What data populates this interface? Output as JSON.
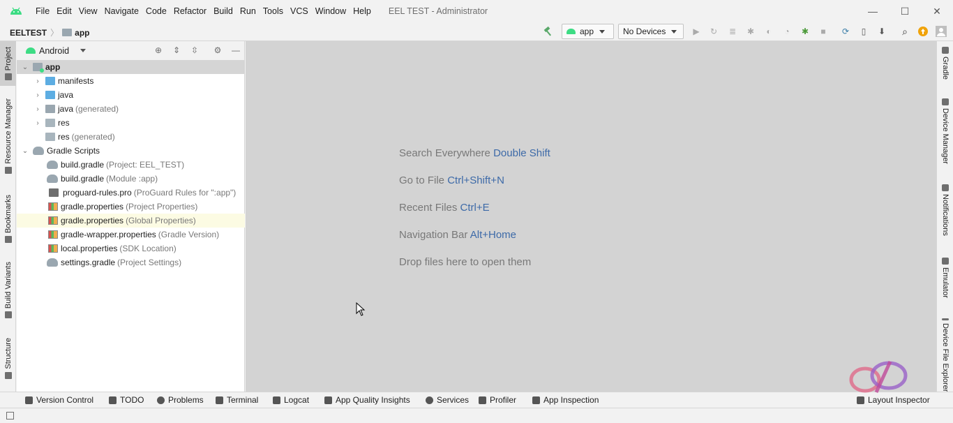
{
  "window": {
    "menu": [
      "File",
      "Edit",
      "View",
      "Navigate",
      "Code",
      "Refactor",
      "Build",
      "Run",
      "Tools",
      "VCS",
      "Window",
      "Help"
    ],
    "title": "EEL TEST - Administrator",
    "controls": {
      "minimize": "—",
      "maximize": "☐",
      "close": "✕"
    }
  },
  "navbar": {
    "project": "EELTEST",
    "module": "app",
    "run_config": "app",
    "device": "No Devices"
  },
  "left_tabs": [
    "Project",
    "Resource Manager",
    "Bookmarks",
    "Build Variants",
    "Structure"
  ],
  "right_tabs": [
    "Gradle",
    "Device Manager",
    "Notifications",
    "Emulator",
    "Device File Explorer"
  ],
  "project_panel": {
    "view": "Android",
    "tree": [
      {
        "name": "app",
        "hint": ""
      },
      {
        "name": "manifests",
        "hint": ""
      },
      {
        "name": "java",
        "hint": ""
      },
      {
        "name": "java",
        "hint": "(generated)"
      },
      {
        "name": "res",
        "hint": ""
      },
      {
        "name": "res",
        "hint": "(generated)"
      },
      {
        "name": "Gradle Scripts",
        "hint": ""
      },
      {
        "name": "build.gradle",
        "hint": "(Project: EEL_TEST)"
      },
      {
        "name": "build.gradle",
        "hint": "(Module :app)"
      },
      {
        "name": "proguard-rules.pro",
        "hint": "(ProGuard Rules for \":app\")"
      },
      {
        "name": "gradle.properties",
        "hint": "(Project Properties)"
      },
      {
        "name": "gradle.properties",
        "hint": "(Global Properties)"
      },
      {
        "name": "gradle-wrapper.properties",
        "hint": "(Gradle Version)"
      },
      {
        "name": "local.properties",
        "hint": "(SDK Location)"
      },
      {
        "name": "settings.gradle",
        "hint": "(Project Settings)"
      }
    ]
  },
  "editor": {
    "tips": [
      {
        "text": "Search Everywhere",
        "key": "Double Shift"
      },
      {
        "text": "Go to File",
        "key": "Ctrl+Shift+N"
      },
      {
        "text": "Recent Files",
        "key": "Ctrl+E"
      },
      {
        "text": "Navigation Bar",
        "key": "Alt+Home"
      },
      {
        "text": "Drop files here to open them",
        "key": ""
      }
    ]
  },
  "bottom_tabs": [
    "Version Control",
    "TODO",
    "Problems",
    "Terminal",
    "Logcat",
    "App Quality Insights",
    "Services",
    "Profiler",
    "App Inspection"
  ],
  "bottom_right_tab": "Layout Inspector",
  "colors": {
    "accent_green": "#3ddc84",
    "link_blue": "#3d6aa8",
    "editor_bg": "#d3d3d3",
    "selected_row": "#d5d5d5",
    "highlight_row": "#fcfbe3"
  }
}
